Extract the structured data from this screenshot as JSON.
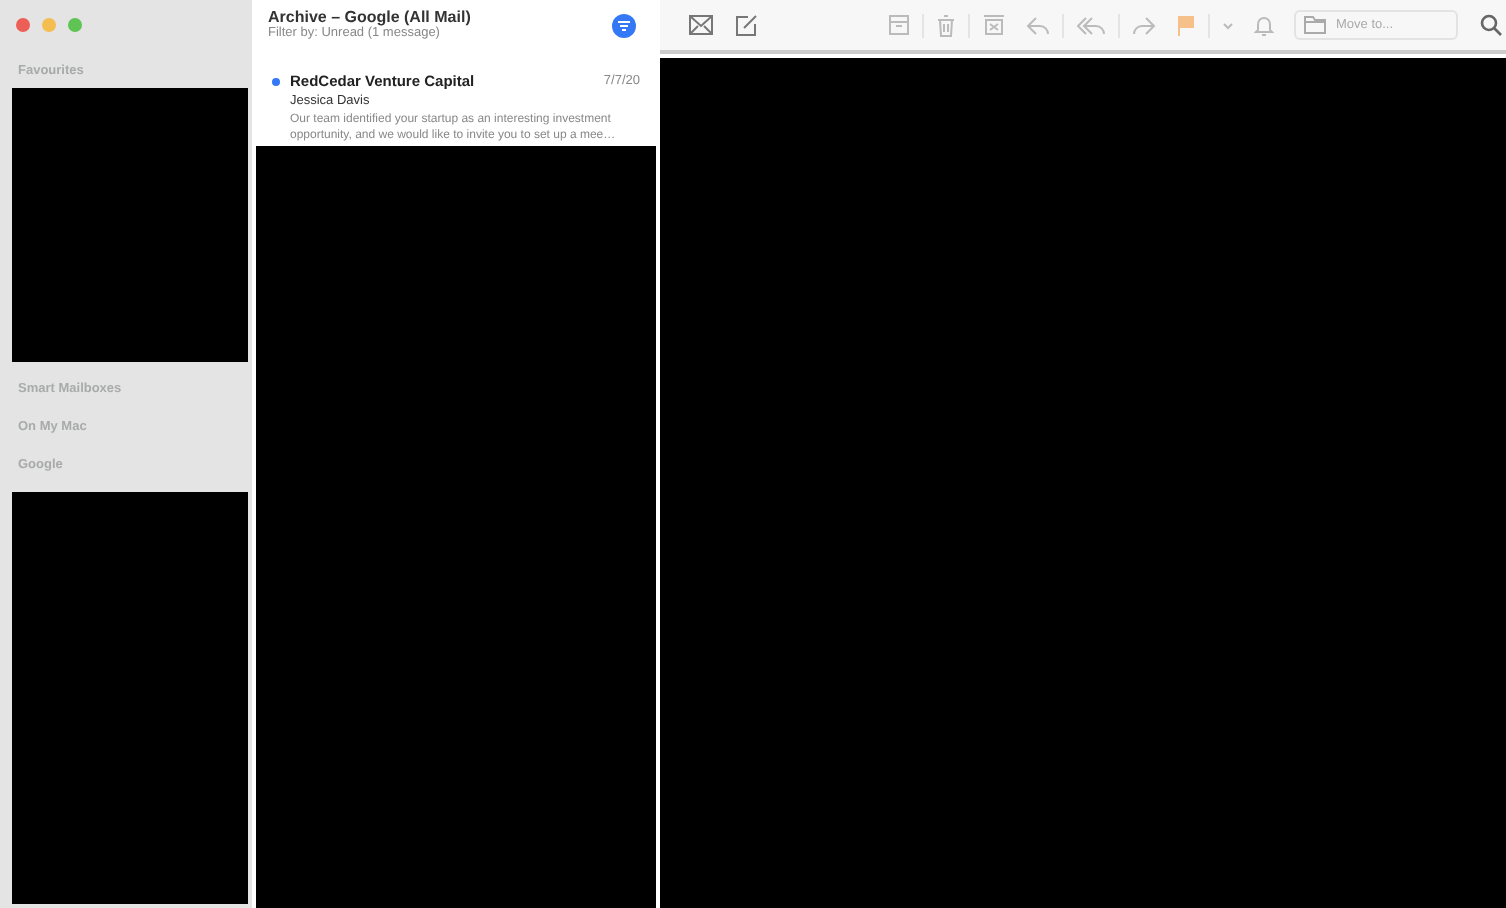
{
  "sidebar": {
    "sections": [
      {
        "label": "Favourites",
        "redacted": true
      },
      {
        "label": "Smart Mailboxes",
        "redacted": false
      },
      {
        "label": "On My Mac",
        "redacted": false
      },
      {
        "label": "Google",
        "redacted": true
      }
    ]
  },
  "list_header": {
    "title": "Archive – Google (All Mail)",
    "filter": "Filter by: Unread (1 message)",
    "filter_on": true
  },
  "messages": [
    {
      "sender": "RedCedar Venture Capital",
      "date": "7/7/20",
      "to": "Jessica Davis",
      "preview": "Our team identified your startup as an interesting investment opportunity, and we would like to invite you to set up a mee…",
      "unread": true
    }
  ],
  "toolbar": {
    "move_placeholder": "Move to..."
  }
}
